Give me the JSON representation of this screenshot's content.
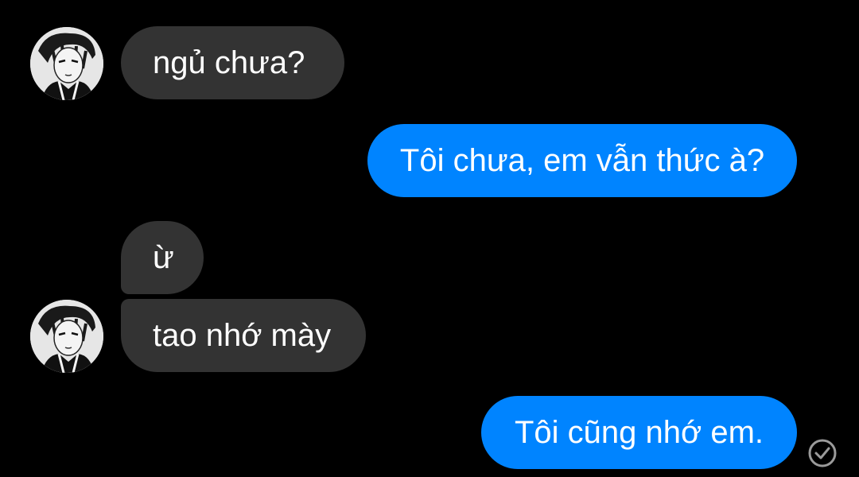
{
  "conversation": {
    "messages": [
      {
        "sender": "them",
        "text": "ngủ chưa?"
      },
      {
        "sender": "me",
        "text": "Tôi chưa, em vẫn thức à?"
      },
      {
        "sender": "them",
        "text": "ừ"
      },
      {
        "sender": "them",
        "text": "tao nhớ mày"
      },
      {
        "sender": "me",
        "text": "Tôi cũng nhớ em."
      }
    ],
    "contact_avatar_icon": "manga-character-avatar",
    "read_receipt_icon": "check-circle-icon"
  },
  "colors": {
    "background": "#000000",
    "incoming_bubble": "#333333",
    "outgoing_bubble": "#0084ff",
    "text": "#ffffff"
  }
}
